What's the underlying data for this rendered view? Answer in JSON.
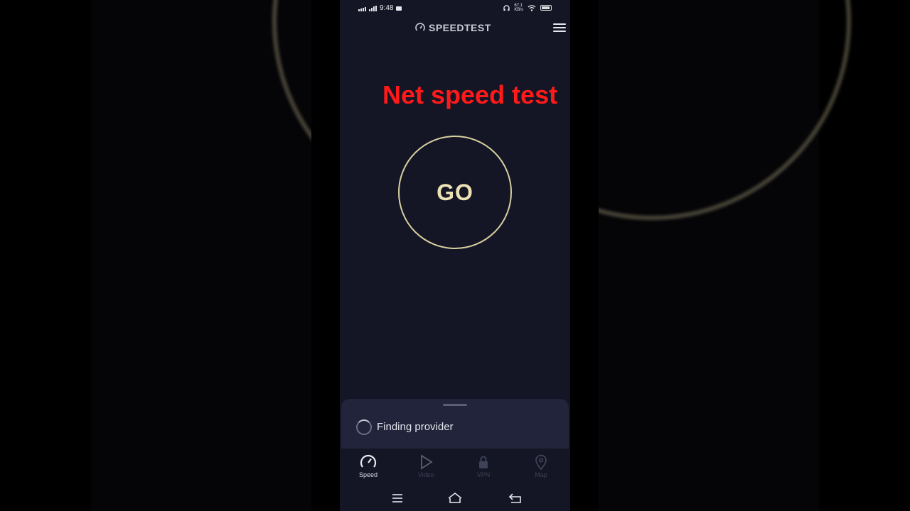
{
  "status_bar": {
    "time": "9:48",
    "network_small_top": "67.1",
    "network_small_bottom": "KB/s",
    "battery_level": "78"
  },
  "header": {
    "brand": "SPEEDTEST"
  },
  "overlay": {
    "title": "Net speed test",
    "color": "#ff1a1a"
  },
  "go_button": {
    "label": "GO"
  },
  "provider": {
    "status": "Finding provider"
  },
  "tabs": [
    {
      "label": "Speed",
      "icon": "speedometer-icon",
      "active": true
    },
    {
      "label": "Video",
      "icon": "play-icon",
      "active": false
    },
    {
      "label": "VPN",
      "icon": "lock-icon",
      "active": false
    },
    {
      "label": "Map",
      "icon": "map-pin-icon",
      "active": false
    }
  ],
  "colors": {
    "background": "#141625",
    "accent": "#ece2b4",
    "sheet": "#21243a"
  }
}
